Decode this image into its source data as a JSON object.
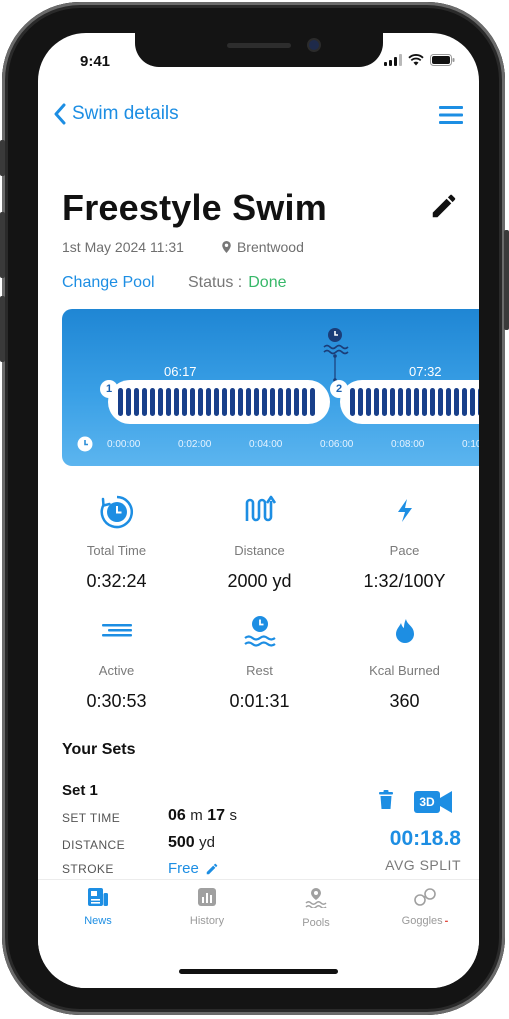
{
  "status_bar": {
    "time": "9:41"
  },
  "nav": {
    "back_label": "Swim details"
  },
  "swim": {
    "title": "Freestyle Swim",
    "datetime": "1st May 2024 11:31",
    "location": "Brentwood",
    "change_pool_label": "Change Pool",
    "status_label": "Status :",
    "status_value": "Done"
  },
  "timeline": {
    "laps": [
      {
        "number": "1",
        "time": "06:17"
      },
      {
        "number": "2",
        "time": "07:32"
      }
    ],
    "ticks": [
      "0:00:00",
      "0:02:00",
      "0:04:00",
      "0:06:00",
      "0:08:00",
      "0:10"
    ]
  },
  "stats": [
    {
      "label": "Total Time",
      "value": "0:32:24",
      "icon": "timer-icon"
    },
    {
      "label": "Distance",
      "value": "2000 yd",
      "icon": "distance-icon"
    },
    {
      "label": "Pace",
      "value": "1:32/100Y",
      "icon": "bolt-icon"
    },
    {
      "label": "Active",
      "value": "0:30:53",
      "icon": "active-lines-icon"
    },
    {
      "label": "Rest",
      "value": "0:01:31",
      "icon": "rest-icon"
    },
    {
      "label": "Kcal Burned",
      "value": "360",
      "icon": "flame-icon"
    }
  ],
  "sets": {
    "title": "Your Sets",
    "items": [
      {
        "name": "Set 1",
        "set_time_label": "SET TIME",
        "set_time_min": "06",
        "set_time_min_unit": "m",
        "set_time_sec": "17",
        "set_time_sec_unit": "s",
        "distance_label": "DISTANCE",
        "distance_value": "500",
        "distance_unit": "yd",
        "stroke_label": "STROKE",
        "stroke_value": "Free",
        "avg_split_value": "00:18.8",
        "avg_split_label": "AVG SPLIT",
        "btn_3d_label": "3D"
      }
    ]
  },
  "tabs": [
    {
      "label": "News",
      "active": true
    },
    {
      "label": "History",
      "active": false
    },
    {
      "label": "Pools",
      "active": false
    },
    {
      "label": "Goggles",
      "active": false,
      "badge": "-"
    }
  ],
  "colors": {
    "accent": "#1d8ee3",
    "done": "#37b869",
    "bar": "#183f8a"
  }
}
